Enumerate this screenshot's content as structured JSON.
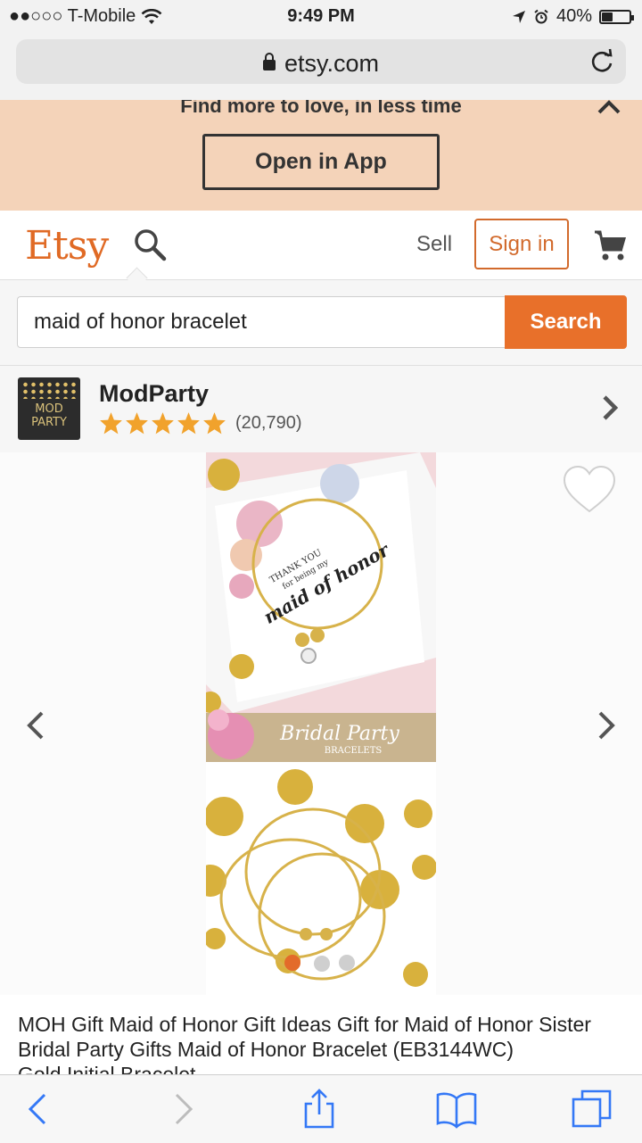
{
  "status_bar": {
    "carrier": "●●○○○ T-Mobile",
    "time": "9:49 PM",
    "battery": "40%",
    "battery_fraction": 0.4
  },
  "browser": {
    "url": "etsy.com"
  },
  "app_banner": {
    "message": "Find more to love, in less time",
    "open_button": "Open in App"
  },
  "header": {
    "logo": "Etsy",
    "sell": "Sell",
    "sign_in": "Sign in"
  },
  "search": {
    "query": "maid of honor bracelet",
    "button": "Search"
  },
  "shop": {
    "logo_text_1": "MOD",
    "logo_text_2": "PARTY",
    "name": "ModParty",
    "rating": 5,
    "reviews": "(20,790)"
  },
  "product": {
    "image_text": {
      "thank_you": "THANK YOU",
      "for_being": "for being my",
      "script": "maid of honor",
      "bridal": "Bridal Party",
      "bracelets": "BRACELETS"
    },
    "title": "MOH Gift Maid of Honor Gift Ideas Gift for Maid of Honor Sister Bridal Party Gifts Maid of Honor Bracelet (EB3144WC)",
    "title_tail": "Gold Initial Bracelet"
  },
  "colors": {
    "accent": "#e8702a",
    "banner": "#f4d3b9",
    "star": "#f1a22c"
  }
}
